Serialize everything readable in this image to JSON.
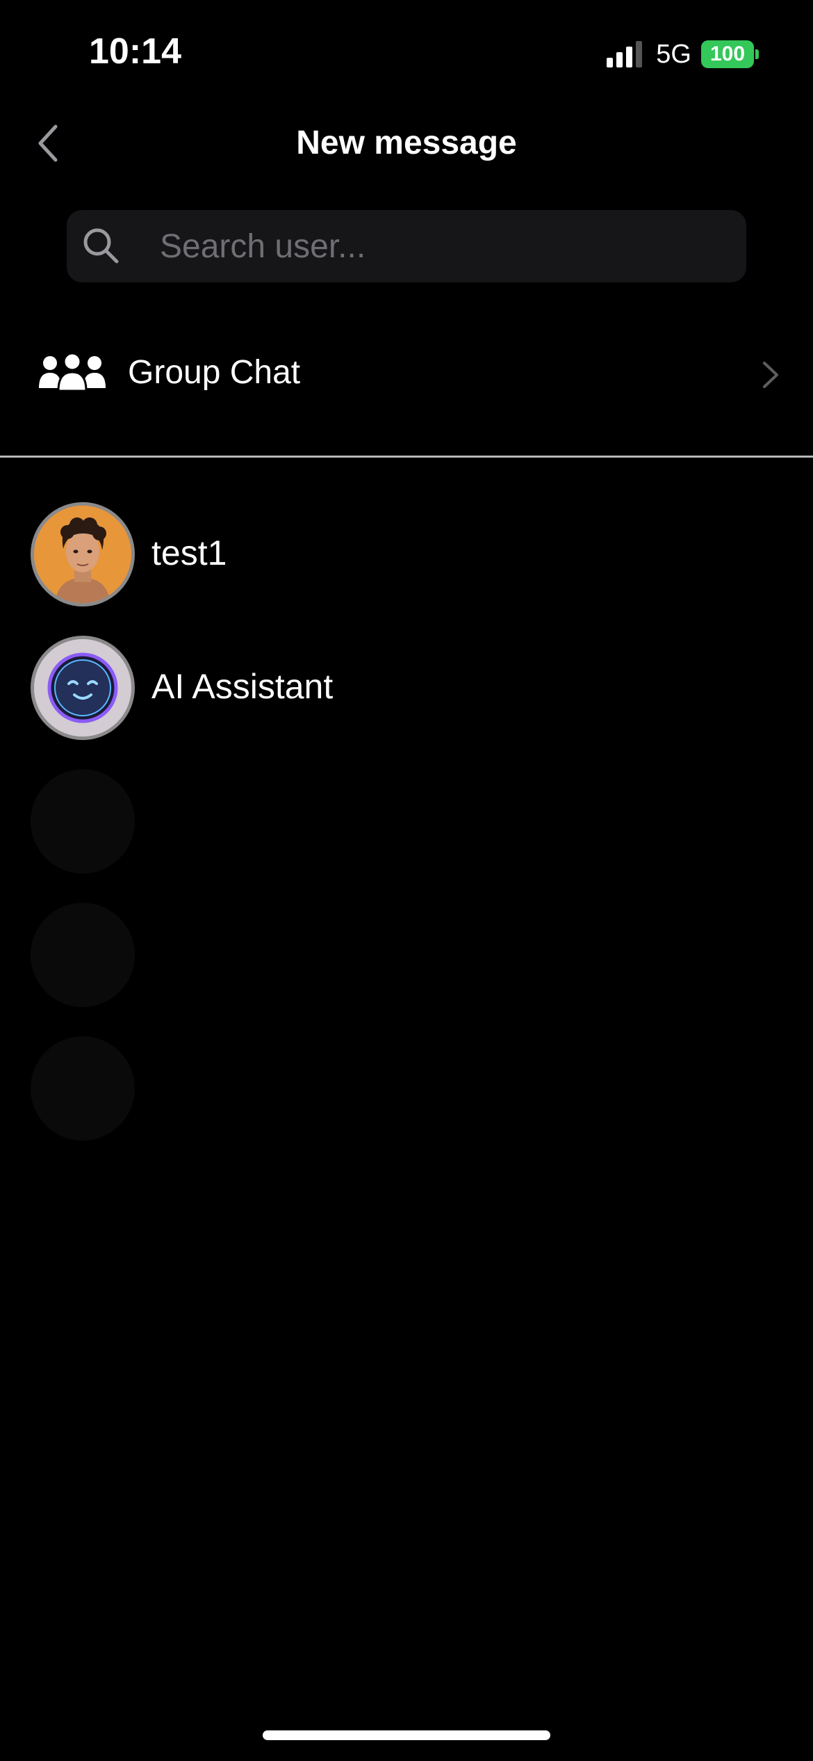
{
  "status_bar": {
    "time": "10:14",
    "network": "5G",
    "battery_level": "100",
    "battery_color": "#34c759",
    "signal_bars_active": 3,
    "signal_bars_total": 4
  },
  "header": {
    "title": "New message",
    "back_icon": "chevron-left-icon"
  },
  "search": {
    "placeholder": "Search user...",
    "value": "",
    "icon": "search-icon"
  },
  "group_chat": {
    "label": "Group Chat",
    "icon": "group-icon",
    "chevron_icon": "chevron-right-icon"
  },
  "contacts": [
    {
      "name": "test1",
      "avatar": "portrait-avatar"
    },
    {
      "name": "AI Assistant",
      "avatar": "robot-avatar"
    }
  ],
  "faded_contacts": [
    {
      "name": "",
      "avatar": "placeholder-avatar"
    },
    {
      "name": "",
      "avatar": "placeholder-avatar"
    },
    {
      "name": "",
      "avatar": "placeholder-avatar"
    }
  ],
  "colors": {
    "background": "#000000",
    "search_background": "#161618",
    "placeholder_text": "#6e6e73",
    "divider": "#b8b8b8",
    "avatar_orange": "#e8963a"
  }
}
